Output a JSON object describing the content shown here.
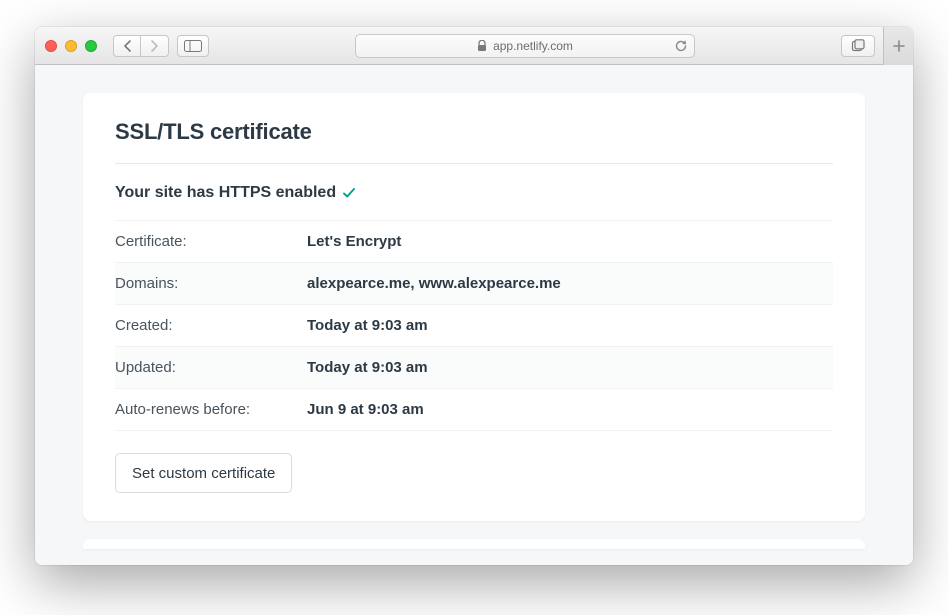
{
  "browser": {
    "url_host": "app.netlify.com"
  },
  "card": {
    "title": "SSL/TLS certificate",
    "status_text": "Your site has HTTPS enabled",
    "rows": [
      {
        "label": "Certificate:",
        "value": "Let's Encrypt"
      },
      {
        "label": "Domains:",
        "value": "alexpearce.me, www.alexpearce.me"
      },
      {
        "label": "Created:",
        "value": "Today at 9:03 am"
      },
      {
        "label": "Updated:",
        "value": "Today at 9:03 am"
      },
      {
        "label": "Auto-renews before:",
        "value": "Jun 9 at 9:03 am"
      }
    ],
    "button_label": "Set custom certificate"
  }
}
